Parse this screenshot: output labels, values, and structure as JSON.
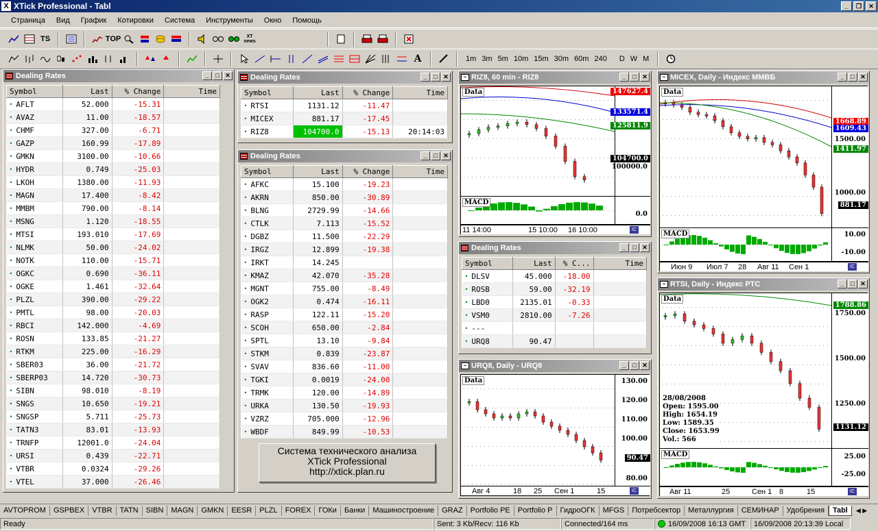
{
  "app": {
    "title": "XTick Professional - Tabl"
  },
  "menu": [
    "Страница",
    "Вид",
    "График",
    "Котировки",
    "Система",
    "Инструменты",
    "Окно",
    "Помощь"
  ],
  "timeframes": [
    "1m",
    "3m",
    "5m",
    "10m",
    "15m",
    "30m",
    "60m",
    "240",
    "D",
    "W",
    "M"
  ],
  "toolbar1_icons": [
    "line-chart-icon",
    "table-icon",
    "ts-icon",
    "list-icon",
    "news-icon",
    "top-icon",
    "search-icon",
    "alert-icon",
    "coins-icon",
    "flag-icon",
    "sound-icon",
    "glasses-icon",
    "glasses2-icon",
    "xt-news-icon",
    "document-icon",
    "print-icon",
    "print-preview-icon",
    "close-doc-icon"
  ],
  "toolbar1_labels": {
    "ts": "TS",
    "top": "TOP",
    "xtnews": "XT news"
  },
  "panel1": {
    "title": "Dealing Rates",
    "cols": [
      "Symbol",
      "Last",
      "% Change",
      "Time"
    ],
    "rows": [
      [
        "AFLT",
        "52.000",
        "-15.31"
      ],
      [
        "AVAZ",
        "11.00",
        "-18.57"
      ],
      [
        "CHMF",
        "327.00",
        "-6.71"
      ],
      [
        "GAZP",
        "160.99",
        "-17.89"
      ],
      [
        "GMKN",
        "3100.00",
        "-10.66"
      ],
      [
        "HYDR",
        "0.749",
        "-25.03"
      ],
      [
        "LKOH",
        "1380.00",
        "-11.93"
      ],
      [
        "MAGN",
        "17.400",
        "-8.42"
      ],
      [
        "MMBM",
        "790.00",
        "-8.14"
      ],
      [
        "MSNG",
        "1.120",
        "-18.55"
      ],
      [
        "MTSI",
        "193.010",
        "-17.69"
      ],
      [
        "NLMK",
        "50.00",
        "-24.02"
      ],
      [
        "NOTK",
        "110.00",
        "-15.71"
      ],
      [
        "OGKC",
        "0.690",
        "-36.11"
      ],
      [
        "OGKE",
        "1.461",
        "-32.64"
      ],
      [
        "PLZL",
        "390.00",
        "-29.22"
      ],
      [
        "PMTL",
        "98.00",
        "-20.03"
      ],
      [
        "RBCI",
        "142.000",
        "-4.69"
      ],
      [
        "ROSN",
        "133.85",
        "-21.27"
      ],
      [
        "RTKM",
        "225.00",
        "-16.29"
      ],
      [
        "SBER03",
        "36.00",
        "-21.72"
      ],
      [
        "SBERP03",
        "14.720",
        "-30.73"
      ],
      [
        "SIBN",
        "98.010",
        "-8.19"
      ],
      [
        "SNGS",
        "10.650",
        "-19.21"
      ],
      [
        "SNGSP",
        "5.711",
        "-25.73"
      ],
      [
        "TATN3",
        "83.01",
        "-13.93"
      ],
      [
        "TRNFP",
        "12001.0",
        "-24.04"
      ],
      [
        "URSI",
        "0.439",
        "-22.71"
      ],
      [
        "VTBR",
        "0.0324",
        "-29.26"
      ],
      [
        "VTEL",
        "37.000",
        "-26.46"
      ]
    ]
  },
  "panel2": {
    "title": "Dealing Rates",
    "cols": [
      "Symbol",
      "Last",
      "% Change",
      "Time"
    ],
    "rows": [
      [
        "RTSI",
        "1131.12",
        "-11.47",
        ""
      ],
      [
        "MICEX",
        "881.17",
        "-17.45",
        ""
      ],
      [
        "RIZ8",
        "104700.0",
        "-15.13",
        "20:14:03"
      ]
    ]
  },
  "panel3": {
    "title": "Dealing Rates",
    "cols": [
      "Symbol",
      "Last",
      "% Change",
      "Time"
    ],
    "rows": [
      [
        "AFKC",
        "15.100",
        "-19.23"
      ],
      [
        "AKRN",
        "850.00",
        "-30.89"
      ],
      [
        "BLNG",
        "2729.99",
        "-14.66"
      ],
      [
        "CTLK",
        "7.113",
        "-15.52"
      ],
      [
        "DGBZ",
        "11.500",
        "-22.29"
      ],
      [
        "IRGZ",
        "12.899",
        "-19.38"
      ],
      [
        "IRKT",
        "14.245",
        ""
      ],
      [
        "KMAZ",
        "42.070",
        "-35.28"
      ],
      [
        "MGNT",
        "755.00",
        "-8.49"
      ],
      [
        "OGK2",
        "0.474",
        "-16.11"
      ],
      [
        "RASP",
        "122.11",
        "-15.20"
      ],
      [
        "SCOH",
        "650.00",
        "-2.84"
      ],
      [
        "SPTL",
        "13.10",
        "-9.84"
      ],
      [
        "STKM",
        "0.839",
        "-23.87"
      ],
      [
        "SVAV",
        "836.60",
        "-11.00"
      ],
      [
        "TGKI",
        "0.0019",
        "-24.00"
      ],
      [
        "TRMK",
        "120.00",
        "-14.89"
      ],
      [
        "URKA",
        "130.50",
        "-19.93"
      ],
      [
        "VZRZ",
        "705.000",
        "-12.96"
      ],
      [
        "WBDF",
        "849.99",
        "-10.53"
      ]
    ]
  },
  "panel4": {
    "title": "Dealing Rates",
    "cols": [
      "Symbol",
      "Last",
      "% C...",
      "Time"
    ],
    "rows": [
      [
        "DLSV",
        "45.000",
        "-18.00"
      ],
      [
        "ROSB",
        "59.00",
        "-32.19"
      ],
      [
        "LBD0",
        "2135.01",
        "-0.33"
      ],
      [
        "VSM0",
        "2810.00",
        "-7.26"
      ],
      [
        "---",
        "",
        ""
      ],
      [
        "URQ8",
        "90.47",
        ""
      ]
    ]
  },
  "chart_riz": {
    "title": "RIZ8, 60 min - RIZ8",
    "data_label": "Data",
    "macd_label": "MACD",
    "tags": [
      "147627.4",
      "133571.4",
      "125811.9",
      "104700.0"
    ],
    "ylabels": [
      "100000.0"
    ],
    "macd_y": [
      "0.0"
    ],
    "xlabels": [
      "11 14:00",
      "15 10:00",
      "16 10:00"
    ]
  },
  "chart_micex": {
    "title": "MICEX, Daily - Индекс ММВБ",
    "data_label": "Data",
    "macd_label": "MACD",
    "tags": [
      "1668.89",
      "1609.43",
      "1411.97",
      "881.17"
    ],
    "ylabels": [
      "1500.00",
      "1000.00"
    ],
    "macd_y": [
      "10.00",
      "-10.00"
    ],
    "xlabels": [
      "Июн 9",
      "Июл 7",
      "28",
      "Авг 11",
      "Сен 1"
    ]
  },
  "chart_urq": {
    "title": "URQ8, Daily - URQ8",
    "data_label": "Data",
    "tags": [
      "90.47"
    ],
    "ylabels": [
      "130.00",
      "120.00",
      "110.00",
      "100.00",
      "80.00"
    ],
    "xlabels": [
      "Авг 4",
      "18",
      "25",
      "Сен 1",
      "15"
    ]
  },
  "chart_rtsi": {
    "title": "RTSI, Daily - Индекс РТС",
    "data_label": "Data",
    "macd_label": "MACD",
    "tags": [
      "1788.86",
      "1131.12"
    ],
    "ylabels": [
      "1750.00",
      "1500.00",
      "1250.00"
    ],
    "macd_y": [
      "25.00",
      "-25.00"
    ],
    "xlabels": [
      "Авг 11",
      "25",
      "Сен 1",
      "8",
      "15"
    ],
    "ohlc": [
      "28/08/2008",
      "Open: 1595.00",
      "High: 1654.19",
      "Low: 1589.35",
      "Close: 1653.99",
      "Vol.: 566"
    ]
  },
  "watermark": [
    "Система технического анализа",
    "XTick Professional",
    "http://xtick.plan.ru"
  ],
  "tabs": [
    "AVTOPROM",
    "GSPBEX",
    "VTBR",
    "TATN",
    "SIBN",
    "MAGN",
    "GMKN",
    "EESR",
    "PLZL",
    "FOREX",
    "ГОКи",
    "Банки",
    "Машиностроение",
    "GRAZ",
    "Portfolio PE",
    "Portfolio P",
    "ГидроОГК",
    "MFGS",
    "Потребсектор",
    "Металлургия",
    "СЕМИНАР",
    "Удобрения",
    "Tabl"
  ],
  "status": {
    "ready": "Ready",
    "traffic": "Sent: 3 Kb/Recv: 116 Kb",
    "conn": "Connected/164 ms",
    "gmt": "16/09/2008 16:13 GMT",
    "local": "16/09/2008 20:13:39 Local"
  },
  "chart_data": [
    {
      "type": "line",
      "name": "RIZ8, 60 min",
      "series": [
        {
          "values": [
            123000,
            124500,
            125500,
            126000,
            127000,
            127500,
            126500,
            125000,
            122000,
            118000,
            112000,
            106000,
            104700
          ]
        }
      ]
    },
    {
      "type": "line",
      "name": "MICEX, Daily",
      "series": [
        {
          "values": [
            1800,
            1780,
            1760,
            1720,
            1700,
            1690,
            1650,
            1600,
            1550,
            1520,
            1500,
            1510,
            1470,
            1450,
            1400,
            1350,
            1300,
            1200,
            1100,
            881.17
          ]
        }
      ]
    },
    {
      "type": "line",
      "name": "URQ8, Daily",
      "series": [
        {
          "values": [
            119,
            115,
            113,
            111,
            112,
            111,
            113,
            114,
            112,
            109,
            107,
            105,
            103,
            100,
            97,
            94,
            90.47
          ]
        }
      ]
    },
    {
      "type": "line",
      "name": "RTSI, Daily",
      "series": [
        {
          "values": [
            1750,
            1760,
            1720,
            1700,
            1680,
            1650,
            1600,
            1620,
            1640,
            1600,
            1550,
            1500,
            1450,
            1380,
            1300,
            1250,
            1131.12
          ]
        }
      ]
    }
  ]
}
